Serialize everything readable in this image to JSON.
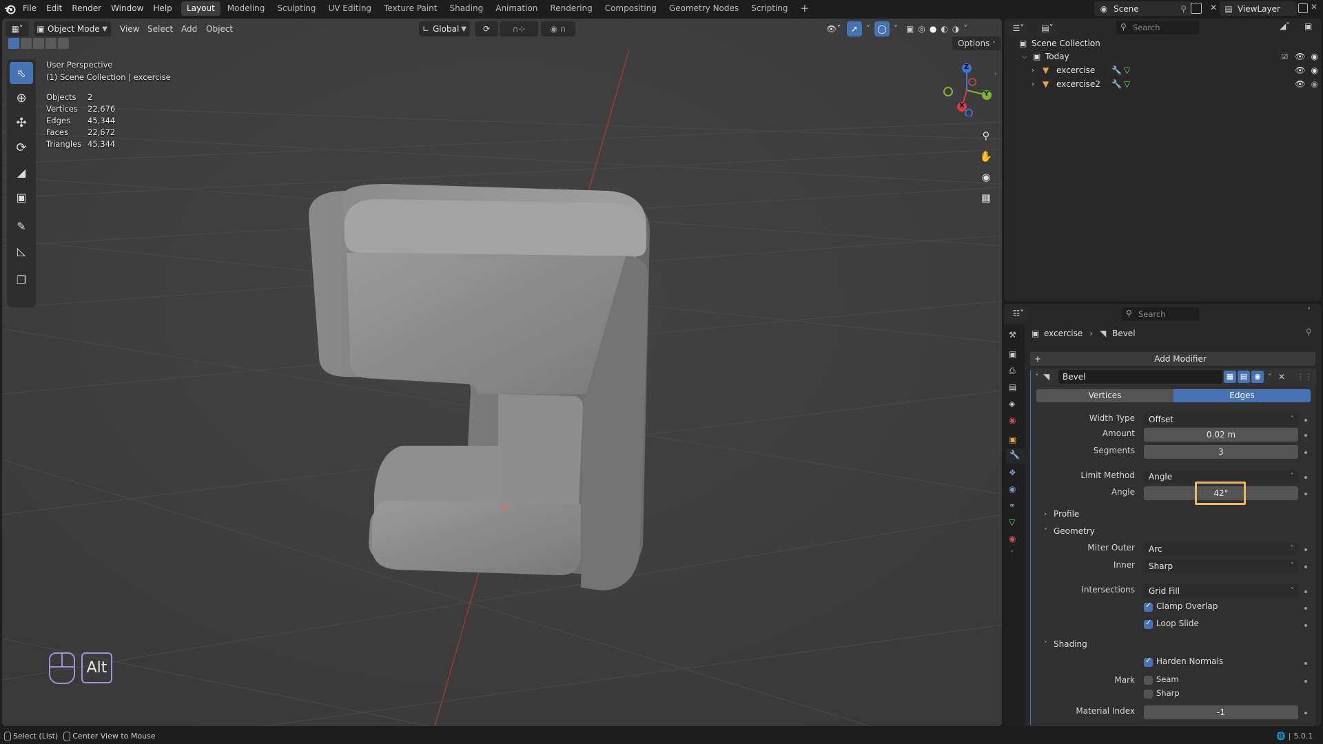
{
  "topbar": {
    "menus": [
      "File",
      "Edit",
      "Render",
      "Window",
      "Help"
    ],
    "workspaces": [
      "Layout",
      "Modeling",
      "Sculpting",
      "UV Editing",
      "Texture Paint",
      "Shading",
      "Animation",
      "Rendering",
      "Compositing",
      "Geometry Nodes",
      "Scripting"
    ],
    "active_workspace": "Layout",
    "add_tab": "+",
    "scene": "Scene",
    "view_layer": "ViewLayer"
  },
  "viewport": {
    "mode": "Object Mode",
    "menus": [
      "View",
      "Select",
      "Add",
      "Object"
    ],
    "orientation": "Global",
    "options": "Options",
    "overlay_title": "User Perspective",
    "overlay_collection": "(1) Scene Collection | excercise",
    "stats": [
      {
        "label": "Objects",
        "value": "2"
      },
      {
        "label": "Vertices",
        "value": "22,676"
      },
      {
        "label": "Edges",
        "value": "45,344"
      },
      {
        "label": "Faces",
        "value": "22,672"
      },
      {
        "label": "Triangles",
        "value": "45,344"
      }
    ],
    "gizmo": {
      "x": "X",
      "y": "Y",
      "z": "Z"
    },
    "key_hint": "Alt",
    "colors": {
      "background": "#3e3e3e",
      "grid": "#474747",
      "x_axis": "#a33a3a",
      "mesh": "#8a8a8a",
      "accent": "#4772b3"
    }
  },
  "outliner": {
    "search_placeholder": "Search",
    "root": "Scene Collection",
    "collection": "Today",
    "objects": [
      "excercise",
      "excercise2"
    ]
  },
  "properties": {
    "search_placeholder": "Search",
    "breadcrumb_object": "excercise",
    "breadcrumb_modifier": "Bevel",
    "add_modifier": "Add Modifier",
    "modifier_name": "Bevel",
    "tabs": [
      "Vertices",
      "Edges"
    ],
    "active_tab": "Edges",
    "width_type_label": "Width Type",
    "width_type": "Offset",
    "amount_label": "Amount",
    "amount": "0.02 m",
    "segments_label": "Segments",
    "segments": "3",
    "limit_method_label": "Limit Method",
    "limit_method": "Angle",
    "angle_label": "Angle",
    "angle": "42°",
    "profile": "Profile",
    "geometry": "Geometry",
    "miter_outer_label": "Miter Outer",
    "miter_outer": "Arc",
    "inner_label": "Inner",
    "inner": "Sharp",
    "intersections_label": "Intersections",
    "intersections": "Grid Fill",
    "clamp_overlap": "Clamp Overlap",
    "loop_slide": "Loop Slide",
    "shading": "Shading",
    "harden_normals": "Harden Normals",
    "mark_label": "Mark",
    "seam": "Seam",
    "sharp": "Sharp",
    "material_index_label": "Material Index",
    "material_index": "-1",
    "highlight_color": "#e8b96a"
  },
  "statusbar": {
    "select": "Select (List)",
    "center": "Center View to Mouse",
    "version": "5.0.1"
  }
}
